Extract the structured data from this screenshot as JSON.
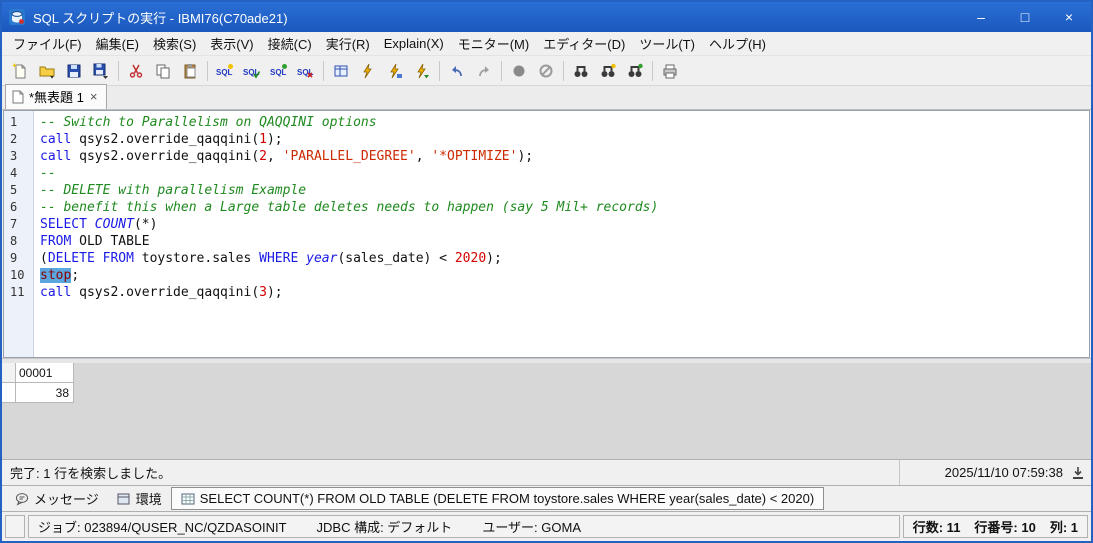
{
  "window": {
    "title": "SQL スクリプトの実行 - IBMI76(C70ade21)",
    "controls": [
      "–",
      "□",
      "×"
    ]
  },
  "colors": {
    "titlebar": "#1f5fc6",
    "keyword": "#1a1ae6",
    "comment": "#1f8a1f",
    "literal": "#d40000",
    "selection": "#5aa7e0"
  },
  "menu": [
    "ファイル(F)",
    "編集(E)",
    "検索(S)",
    "表示(V)",
    "接続(C)",
    "実行(R)",
    "Explain(X)",
    "モニター(M)",
    "エディター(D)",
    "ツール(T)",
    "ヘルプ(H)"
  ],
  "toolbar_icons": [
    "new-script",
    "open",
    "save",
    "save-dropdown",
    "cut",
    "copy",
    "paste",
    "sql-syntax-check",
    "sql-format",
    "sql-validate",
    "sql-generate",
    "insert-from-examples",
    "run-all",
    "run-selected",
    "run-from-cursor",
    "undo",
    "redo",
    "record",
    "stop-run",
    "find",
    "find-next",
    "find-selection",
    "printer"
  ],
  "editor_tab": {
    "label": "*無表題 1",
    "close": "×"
  },
  "code": {
    "lines": [
      [
        {
          "c": "com",
          "t": "-- Switch to Parallelism on QAQQINI options"
        }
      ],
      [
        {
          "c": "kw",
          "t": "call"
        },
        {
          "c": "pl",
          "t": " qsys2.override_qaqqini("
        },
        {
          "c": "num",
          "t": "1"
        },
        {
          "c": "pl",
          "t": ");"
        }
      ],
      [
        {
          "c": "kw",
          "t": "call"
        },
        {
          "c": "pl",
          "t": " qsys2.override_qaqqini("
        },
        {
          "c": "num",
          "t": "2"
        },
        {
          "c": "pl",
          "t": ", "
        },
        {
          "c": "str",
          "t": "'PARALLEL_DEGREE'"
        },
        {
          "c": "pl",
          "t": ", "
        },
        {
          "c": "str",
          "t": "'*OPTIMIZE'"
        },
        {
          "c": "pl",
          "t": ");"
        }
      ],
      [
        {
          "c": "com",
          "t": "--"
        }
      ],
      [
        {
          "c": "com",
          "t": "-- DELETE with parallelism Example"
        }
      ],
      [
        {
          "c": "com",
          "t": "-- benefit this when a Large table deletes needs to happen (say 5 Mil+ records)"
        }
      ],
      [
        {
          "c": "kw",
          "t": "SELECT "
        },
        {
          "c": "fn",
          "t": "COUNT"
        },
        {
          "c": "pl",
          "t": "(*)"
        }
      ],
      [
        {
          "c": "kw",
          "t": "FROM"
        },
        {
          "c": "pl",
          "t": " OLD TABLE"
        }
      ],
      [
        {
          "c": "pl",
          "t": "("
        },
        {
          "c": "kw",
          "t": "DELETE FROM"
        },
        {
          "c": "pl",
          "t": " toystore.sales "
        },
        {
          "c": "kw",
          "t": "WHERE"
        },
        {
          "c": "pl",
          "t": " "
        },
        {
          "c": "fn",
          "t": "year"
        },
        {
          "c": "pl",
          "t": "(sales_date) < "
        },
        {
          "c": "num",
          "t": "2020"
        },
        {
          "c": "pl",
          "t": ");"
        }
      ],
      [
        {
          "c": "sel",
          "t": "stop"
        },
        {
          "c": "pl",
          "t": ";"
        }
      ],
      [
        {
          "c": "kw",
          "t": "call"
        },
        {
          "c": "pl",
          "t": " qsys2.override_qaqqini("
        },
        {
          "c": "num",
          "t": "3"
        },
        {
          "c": "pl",
          "t": ");"
        }
      ]
    ]
  },
  "results": {
    "header": "00001",
    "value": "38"
  },
  "status_line": {
    "text": "完了: 1 行を検索しました。",
    "timestamp": "2025/11/10 07:59:38"
  },
  "bottom_tabs": [
    {
      "label": "メッセージ"
    },
    {
      "label": "環境"
    },
    {
      "label": "SELECT COUNT(*) FROM OLD TABLE (DELETE FROM toystore.sales WHERE year(sales_date) < 2020)"
    }
  ],
  "status_bar": {
    "job": "ジョブ: 023894/QUSER_NC/QZDASOINIT",
    "jdbc": "JDBC 構成: デフォルト",
    "user": "ユーザー: GOMA",
    "rows": "行数: 11",
    "line": "行番号: 10",
    "col": "列: 1"
  }
}
